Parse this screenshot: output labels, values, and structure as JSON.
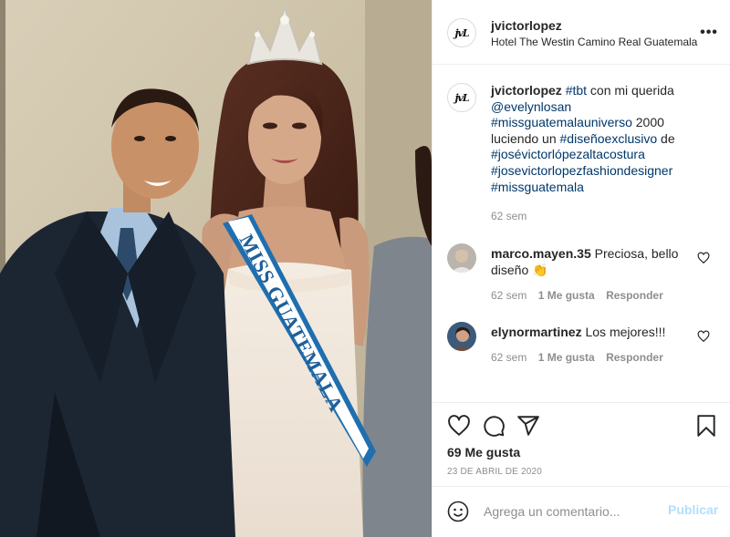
{
  "post": {
    "username": "jvictorlopez",
    "location": "Hotel The Westin Camino Real Guatemala",
    "logo_text": "jvL",
    "sash_text": "MISS GUATEMALA"
  },
  "caption": {
    "username": "jvictorlopez",
    "hashtag_tbt": "#tbt",
    "text_1": " con mi querida ",
    "mention": "@evelynlosan",
    "hashtag_missuniverso": "#missguatemalauniverso",
    "text_2": " 2000 luciendo un ",
    "hashtag_diseno": "#diseñoexclusivo",
    "text_3": " de ",
    "hashtag_altacostura": "#josévictorlópezaltacostura",
    "hashtag_designer": "#josevictorlopezfashiondesigner",
    "hashtag_miss": "#missguatemala",
    "time": "62 sem"
  },
  "comments": [
    {
      "username": "marco.mayen.35",
      "text": " Preciosa, bello diseño",
      "emoji": "👏",
      "time": "62 sem",
      "likes": "1 Me gusta",
      "reply": "Responder"
    },
    {
      "username": "elynormartinez",
      "text": " Los mejores!!!",
      "time": "62 sem",
      "likes": "1 Me gusta",
      "reply": "Responder"
    }
  ],
  "actions": {
    "icons": [
      "heart-icon",
      "comment-icon",
      "share-icon",
      "bookmark-icon"
    ],
    "likes": "69 Me gusta",
    "date": "23 DE ABRIL DE 2020"
  },
  "add_comment": {
    "placeholder": "Agrega un comentario...",
    "publish_label": "Publicar"
  },
  "colors": {
    "link": "#00376b",
    "muted": "#8e8e8e",
    "publish_disabled": "#b2dffc",
    "border": "#efefef"
  }
}
